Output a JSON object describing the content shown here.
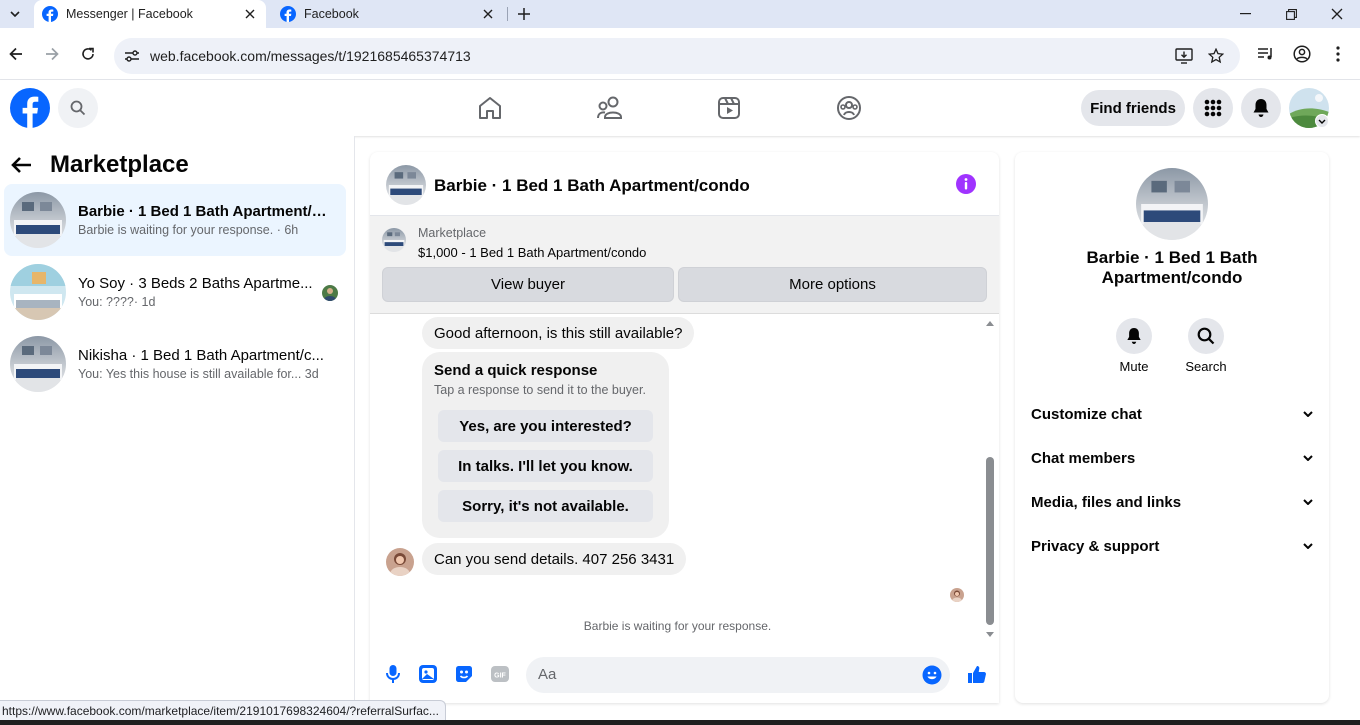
{
  "browser": {
    "tabs": [
      {
        "title": "Messenger | Facebook",
        "active": true
      },
      {
        "title": "Facebook",
        "active": false
      }
    ],
    "url": "web.facebook.com/messages/t/1921685465374713",
    "status_url": "https://www.facebook.com/marketplace/item/2191017698324604/?referralSurfac..."
  },
  "header": {
    "find_friends": "Find friends"
  },
  "sidebar": {
    "title": "Marketplace",
    "conversations": [
      {
        "name": "Barbie · 1 Bed 1 Bath Apartment/c...",
        "snippet": "Barbie is waiting for your response.",
        "time": "· 6h",
        "selected": true
      },
      {
        "name": "Yo Soy · 3 Beds 2 Baths Apartme...",
        "snippet": "You: ????",
        "time": " · 1d",
        "selected": false
      },
      {
        "name": "Nikisha · 1 Bed 1 Bath Apartment/c...",
        "snippet": "You: Yes this house is still available for...",
        "time": "3d",
        "selected": false
      }
    ]
  },
  "chat": {
    "title": "Barbie · 1 Bed 1 Bath Apartment/condo",
    "listing": {
      "label": "Marketplace",
      "price_title": "$1,000 - 1 Bed 1 Bath Apartment/condo",
      "view_buyer": "View buyer",
      "more_options": "More options"
    },
    "messages": {
      "first": "Good afternoon, is this still available?",
      "quick_title": "Send a quick response",
      "quick_sub": "Tap a response to send it to the buyer.",
      "quick_options": [
        "Yes, are you interested?",
        "In talks. I'll let you know.",
        "Sorry, it's not available."
      ],
      "last": "Can you send details. 407 256 3431"
    },
    "waiting": "Barbie is waiting for your response.",
    "composer_placeholder": "Aa"
  },
  "info": {
    "name_line1": "Barbie · 1 Bed 1 Bath",
    "name_line2": "Apartment/condo",
    "actions": [
      "Mute",
      "Search"
    ],
    "rows": [
      "Customize chat",
      "Chat members",
      "Media, files and links",
      "Privacy & support"
    ]
  },
  "colors": {
    "facebook_blue": "#0866ff",
    "messenger_purple": "#a033ff",
    "selected_row": "#ebf5ff"
  },
  "icons": {
    "header_nav": [
      "home-icon",
      "friends-icon",
      "watch-icon",
      "groups-icon"
    ],
    "composer": [
      "microphone-icon",
      "image-icon",
      "sticker-icon",
      "gif-icon",
      "emoji-icon",
      "thumbs-up-icon"
    ]
  }
}
